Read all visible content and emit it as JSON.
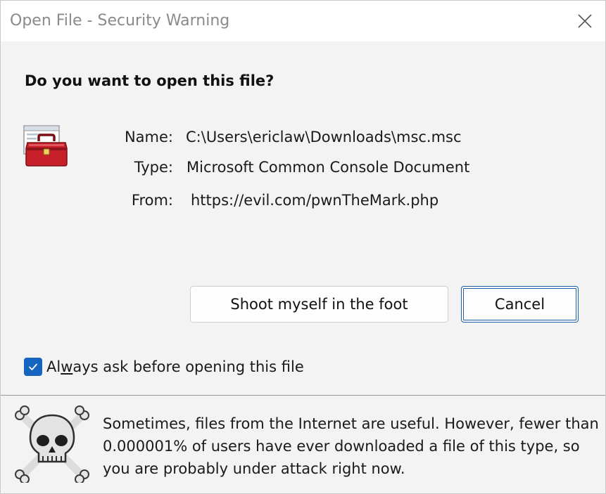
{
  "window": {
    "title": "Open File - Security Warning",
    "close_icon": "close-icon"
  },
  "prompt": {
    "question": "Do you want to open this file?"
  },
  "file_info": {
    "icon": "toolbox-icon",
    "name_label": "Name:",
    "name_value": "C:\\Users\\ericlaw\\Downloads\\msc.msc",
    "type_label": "Type:",
    "type_value": "Microsoft Common Console Document",
    "from_label": "From:",
    "from_value": "https://evil.com/pwnTheMark.php"
  },
  "buttons": {
    "open_label": "Shoot myself in the foot",
    "cancel_label": "Cancel"
  },
  "checkbox": {
    "checked": true,
    "label_before": "Al",
    "label_underlined": "w",
    "label_after": "ays ask before opening this file"
  },
  "footer": {
    "icon": "skull-crossbones-icon",
    "message": "Sometimes, files from the Internet are useful. However, fewer than 0.000001% of users have ever downloaded a file of this type, so you are probably under attack right now."
  },
  "colors": {
    "accent": "#1565c0",
    "focus_border": "#1b5fa8",
    "toolbox_red": "#c8202a"
  }
}
